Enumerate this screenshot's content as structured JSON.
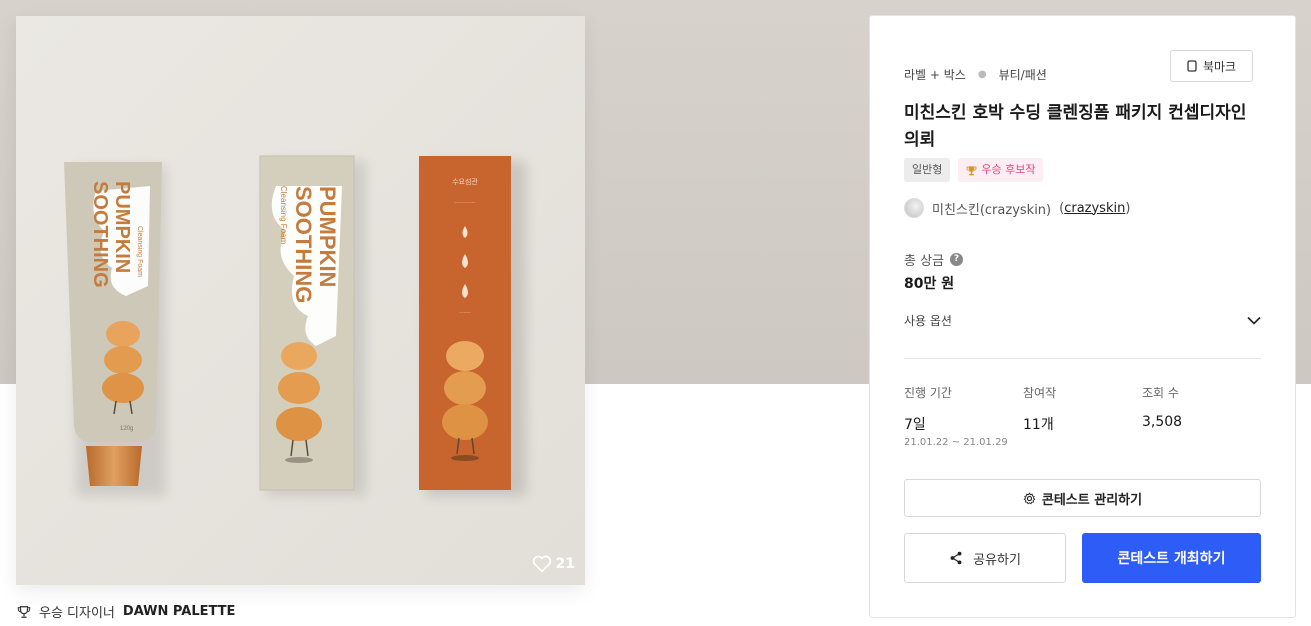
{
  "image": {
    "likes": "21",
    "tube_text": "PUMPKIN\nSOOTHING",
    "tube_sub": "Cleansing Foam",
    "box_text": "PUMPKIN\nSOOTHING",
    "box_sub": "Cleansing Foam",
    "tube_weight": "120g"
  },
  "winner": {
    "prefix": "우승 디자이너",
    "name": "DAWN PALETTE"
  },
  "card": {
    "category_main": "라벨 + 박스",
    "category_sub": "뷰티/패션",
    "bookmark_label": "북마크",
    "title": "미친스킨 호박 수딩 클렌징폼 패키지 컨셉디자인 의뢰",
    "badge_type": "일반형",
    "badge_winner": "우승 후보작",
    "host_name": "미친스킨(crazyskin)",
    "host_link": "crazyskin",
    "prize_label": "총 상금",
    "prize_value": "80만 원",
    "usage_label": "사용 옵션",
    "stats": {
      "period_label": "진행 기간",
      "period_value": "7일",
      "period_dates": "21.01.22 ~ 21.01.29",
      "entries_label": "참여작",
      "entries_value": "11개",
      "views_label": "조회 수",
      "views_value": "3,508"
    },
    "manage_label": "콘테스트 관리하기",
    "share_label": "공유하기",
    "host_label": "콘테스트 개최하기"
  },
  "colors": {
    "primary": "#2d5df6",
    "pink_badge": "#e5457f",
    "box_orange": "#c8642e",
    "tube_orange": "#c47c3e"
  }
}
